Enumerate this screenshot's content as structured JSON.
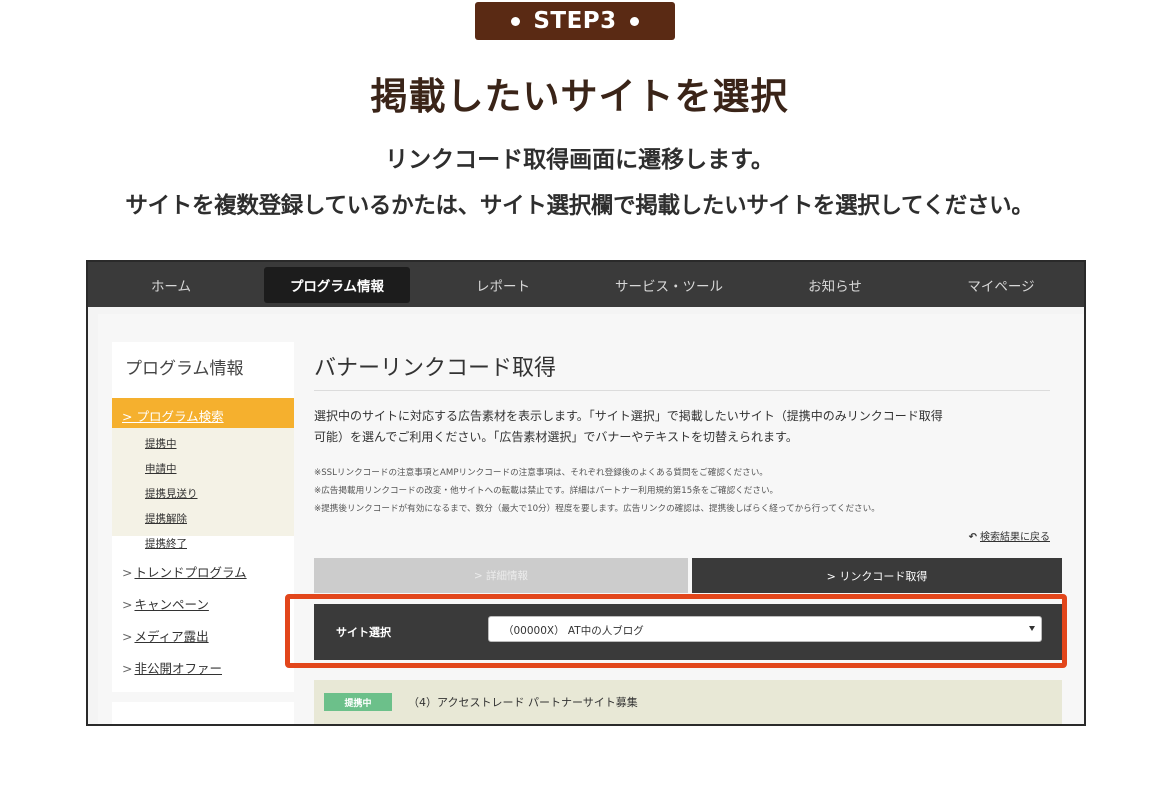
{
  "header": {
    "step_badge": "STEP3",
    "title": "掲載したいサイトを選択",
    "description_line1": "リンクコード取得画面に遷移します。",
    "description_line2": "サイトを複数登録しているかたは、サイト選択欄で掲載したいサイトを選択してください。"
  },
  "topnav": {
    "items": [
      {
        "label": "ホーム"
      },
      {
        "label": "プログラム情報"
      },
      {
        "label": "レポート"
      },
      {
        "label": "サービス・ツール"
      },
      {
        "label": "お知らせ"
      },
      {
        "label": "マイページ"
      }
    ],
    "active_index": 1
  },
  "sidebar": {
    "title": "プログラム情報",
    "active_item": "プログラム検索",
    "sub_items": [
      "提携中",
      "申請中",
      "提携見送り",
      "提携解除",
      "提携終了"
    ],
    "links": [
      "トレンドプログラム",
      "キャンペーン",
      "メディア露出",
      "非公開オファー"
    ],
    "chevron": ">"
  },
  "main": {
    "page_title": "バナーリンクコード取得",
    "intro_line1": "選択中のサイトに対応する広告素材を表示します。「サイト選択」で掲載したいサイト（提携中のみリンクコード取得",
    "intro_line2": "可能）を選んでご利用ください。「広告素材選択」でバナーやテキストを切替えられます。",
    "notes": [
      "※SSLリンクコードの注意事項とAMPリンクコードの注意事項は、それぞれ登録後のよくある質問をご確認ください。",
      "※広告掲載用リンクコードの改変・他サイトへの転載は禁止です。詳細はパートナー利用規約第15条をご確認ください。",
      "※提携後リンクコードが有効になるまで、数分（最大で10分）程度を要します。広告リンクの確認は、提携後しばらく経ってから行ってください。"
    ],
    "back_link": "検索結果に戻る",
    "tab_detail": "> 詳細情報",
    "tab_linkcode": "> リンクコード取得",
    "site_select_label": "サイト選択",
    "site_select_value": "（00000X） AT中の人ブログ",
    "partner_status": "提携中",
    "partner_text": "（4）アクセストレード パートナーサイト募集"
  },
  "colors": {
    "step_badge_bg": "#5a2a14",
    "title_text": "#3a2418",
    "nav_bg": "#3a3a3a",
    "sidebar_active_bg": "#f5b02e",
    "highlight_border": "#e2461b",
    "status_badge_bg": "#6cc08a"
  },
  "icons": {
    "step_dots": "bullet-dot-icon",
    "select_arrow": "caret-down-icon",
    "back_link": "return-arrow-icon"
  }
}
